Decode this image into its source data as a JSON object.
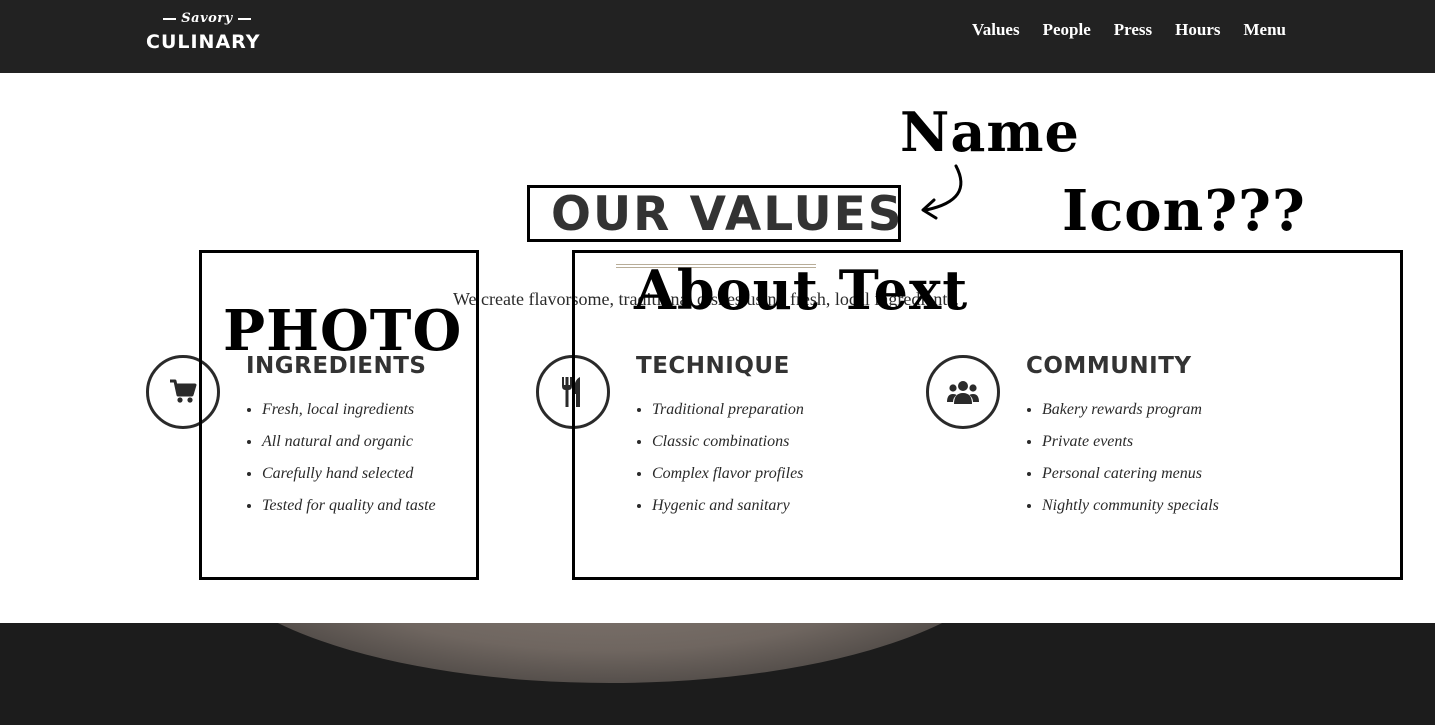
{
  "header": {
    "logo_top": "Savory",
    "logo_bottom": "CULINARY",
    "nav": [
      "Values",
      "People",
      "Press",
      "Hours",
      "Menu"
    ]
  },
  "values": {
    "title": "OUR VALUES",
    "intro": "We create flavorsome, traditional dishes using fresh, local ingredients.",
    "columns": [
      {
        "icon": "shopping-cart-icon",
        "title": "INGREDIENTS",
        "items": [
          "Fresh, local ingredients",
          "All natural and organic",
          "Carefully hand selected",
          "Tested for quality and taste"
        ]
      },
      {
        "icon": "fork-knife-icon",
        "title": "TECHNIQUE",
        "items": [
          "Traditional preparation",
          "Classic combinations",
          "Complex flavor profiles",
          "Hygenic and sanitary"
        ]
      },
      {
        "icon": "users-group-icon",
        "title": "COMMUNITY",
        "items": [
          "Bakery rewards program",
          "Private events",
          "Personal catering menus",
          "Nightly community specials"
        ]
      }
    ]
  },
  "annotations": {
    "name": "Name",
    "icon": "Icon???",
    "about": "About Text",
    "photo": "PHOTO"
  },
  "colors": {
    "header_bg": "#222222",
    "text_dark": "#333333",
    "accent_rule": "#b8ad98",
    "annotation": "#000000"
  }
}
